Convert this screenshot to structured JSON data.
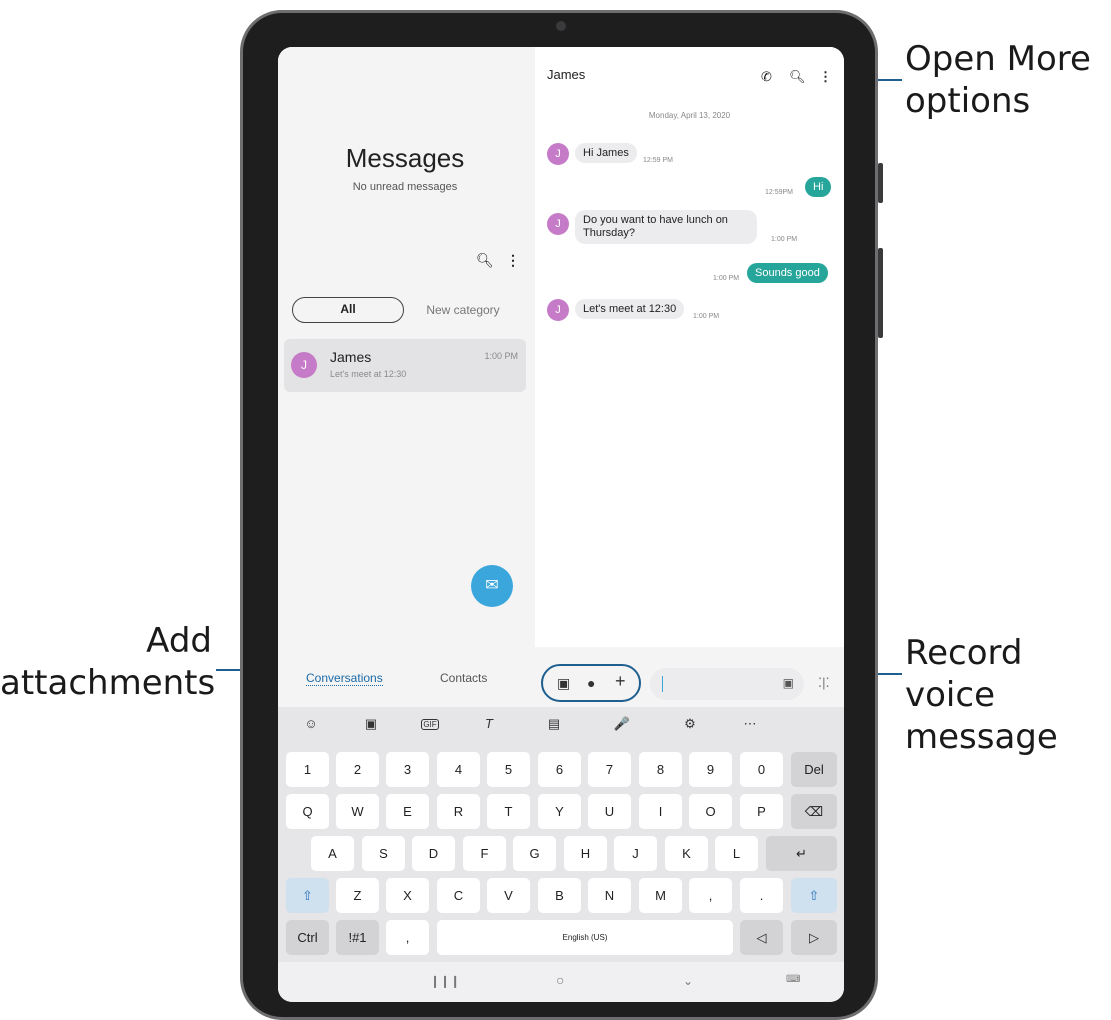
{
  "callouts": {
    "more_options": "Open More options",
    "add_attachments": "Add attachments",
    "record_voice": "Record voice message"
  },
  "left_pane": {
    "title": "Messages",
    "subtitle": "No unread messages",
    "filter_all": "All",
    "filter_new": "New category",
    "conversation": {
      "avatar_letter": "J",
      "name": "James",
      "preview": "Let's meet at 12:30",
      "time": "1:00 PM"
    }
  },
  "chat": {
    "contact_name": "James",
    "date": "Monday, April 13, 2020",
    "messages": [
      {
        "text": "Hi James",
        "time": "12:59 PM",
        "direction": "in"
      },
      {
        "text": "Hi",
        "time": "12:59PM",
        "direction": "out"
      },
      {
        "text": "Do you want to have lunch on Thursday?",
        "time": "1:00 PM",
        "direction": "in"
      },
      {
        "text": "Sounds good",
        "time": "1:00 PM",
        "direction": "out"
      },
      {
        "text": "Let's meet at 12:30",
        "time": "1:00 PM",
        "direction": "in"
      }
    ],
    "avatar_letter": "J"
  },
  "bottom_tabs": {
    "conversations": "Conversations",
    "contacts": "Contacts"
  },
  "keyboard": {
    "toolbar": [
      "☺",
      "▣",
      "GIF",
      "T",
      "▤",
      "🎤",
      "⚙",
      "⋯"
    ],
    "row1": [
      "1",
      "2",
      "3",
      "4",
      "5",
      "6",
      "7",
      "8",
      "9",
      "0",
      "Del"
    ],
    "row2": [
      "Q",
      "W",
      "E",
      "R",
      "T",
      "Y",
      "U",
      "I",
      "O",
      "P",
      "⌫"
    ],
    "row3": [
      "A",
      "S",
      "D",
      "F",
      "G",
      "H",
      "J",
      "K",
      "L",
      "↵"
    ],
    "row4": [
      "⇧",
      "Z",
      "X",
      "C",
      "V",
      "B",
      "N",
      "M",
      ",",
      ".",
      "⇧"
    ],
    "row5": [
      "Ctrl",
      "!#1",
      ",",
      "English (US)",
      "◁",
      "▷"
    ]
  },
  "icons": {
    "call": "call-icon",
    "search": "search-icon",
    "more": "more-vert-icon",
    "compose": "compose-icon",
    "gallery": "gallery-icon",
    "camera": "camera-icon",
    "plus": "plus-icon",
    "sticker": "sticker-icon",
    "voice": "voice-record-icon"
  },
  "colors": {
    "accent": "#26a69a",
    "link": "#1a6aa8",
    "fab": "#3aa6dc",
    "avatar": "#c57bc7",
    "callout_line": "#1f5f8f"
  }
}
